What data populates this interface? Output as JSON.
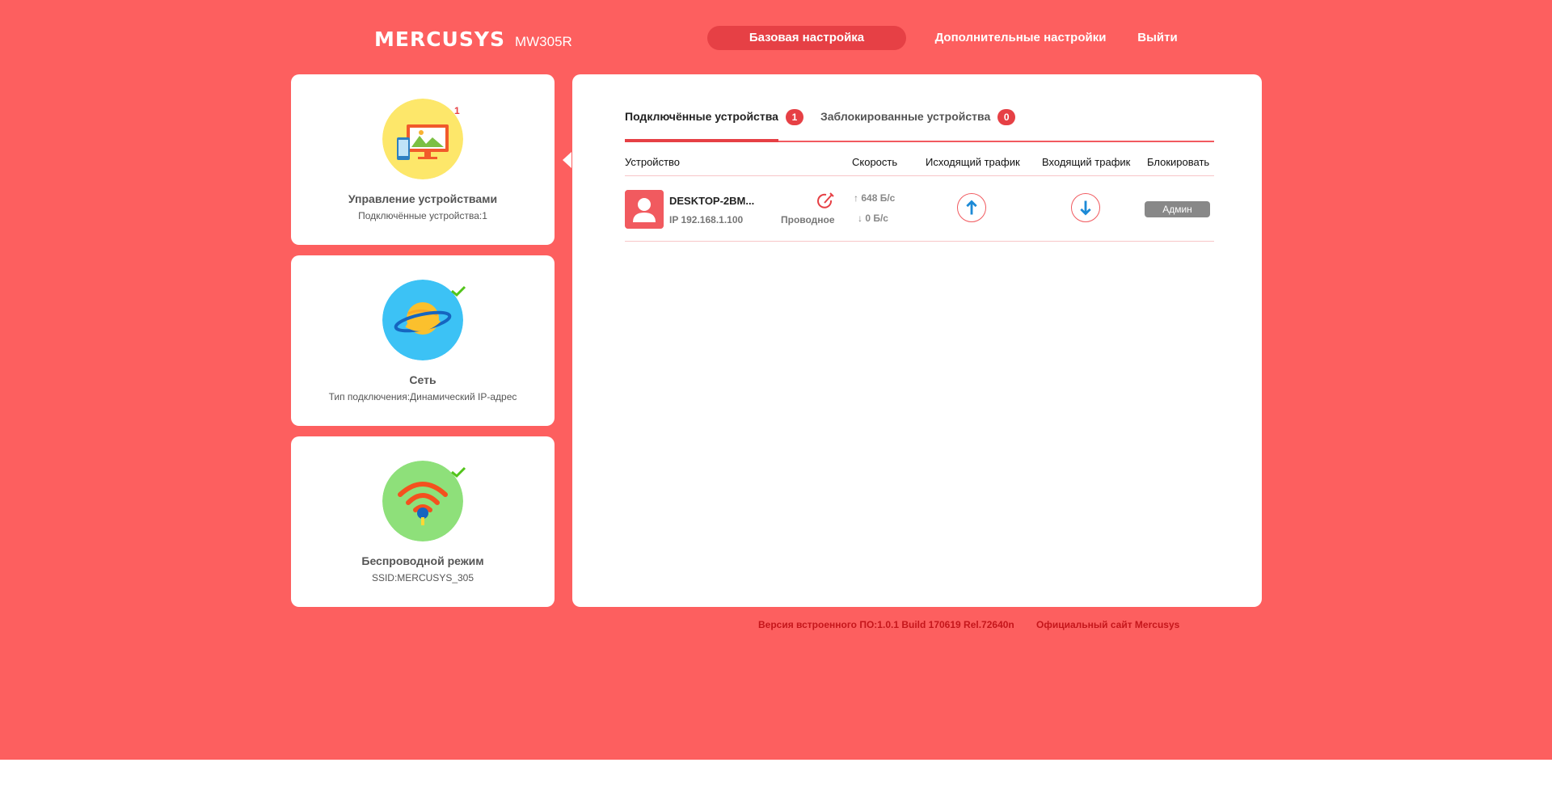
{
  "header": {
    "brand": "MERCUSYS",
    "model": "MW305R",
    "nav": {
      "basic": "Базовая настройка",
      "advanced": "Дополнительные настройки",
      "logout": "Выйти"
    }
  },
  "sidebar": {
    "cards": [
      {
        "title": "Управление устройствами",
        "subtitle": "Подключённые устройства:1",
        "badge": "1",
        "icon": "devices-icon"
      },
      {
        "title": "Сеть",
        "subtitle": "Тип подключения:Динамический IP-адрес",
        "icon": "planet-icon"
      },
      {
        "title": "Беспроводной режим",
        "subtitle": "SSID:MERCUSYS_305",
        "icon": "wifi-icon"
      }
    ]
  },
  "main": {
    "tabs": [
      {
        "label": "Подключённые устройства",
        "count": "1"
      },
      {
        "label": "Заблокированные устройства",
        "count": "0"
      }
    ],
    "columns": {
      "device": "Устройство",
      "speed": "Скорость",
      "upload": "Исходящий трафик",
      "download": "Входящий трафик",
      "block": "Блокировать"
    },
    "rows": [
      {
        "name": "DESKTOP-2BM...",
        "ip": "IP 192.168.1.100",
        "connection": "Проводное",
        "speed_up": "648 Б/с",
        "speed_down": "0 Б/с",
        "block_label": "Админ"
      }
    ]
  },
  "footer": {
    "version": "Версия встроенного ПО:1.0.1 Build 170619 Rel.72640n",
    "site_link": "Официальный сайт Mercusys"
  },
  "colors": {
    "background": "#fd5f5f",
    "accent": "#e64045",
    "panel": "#ffffff"
  }
}
